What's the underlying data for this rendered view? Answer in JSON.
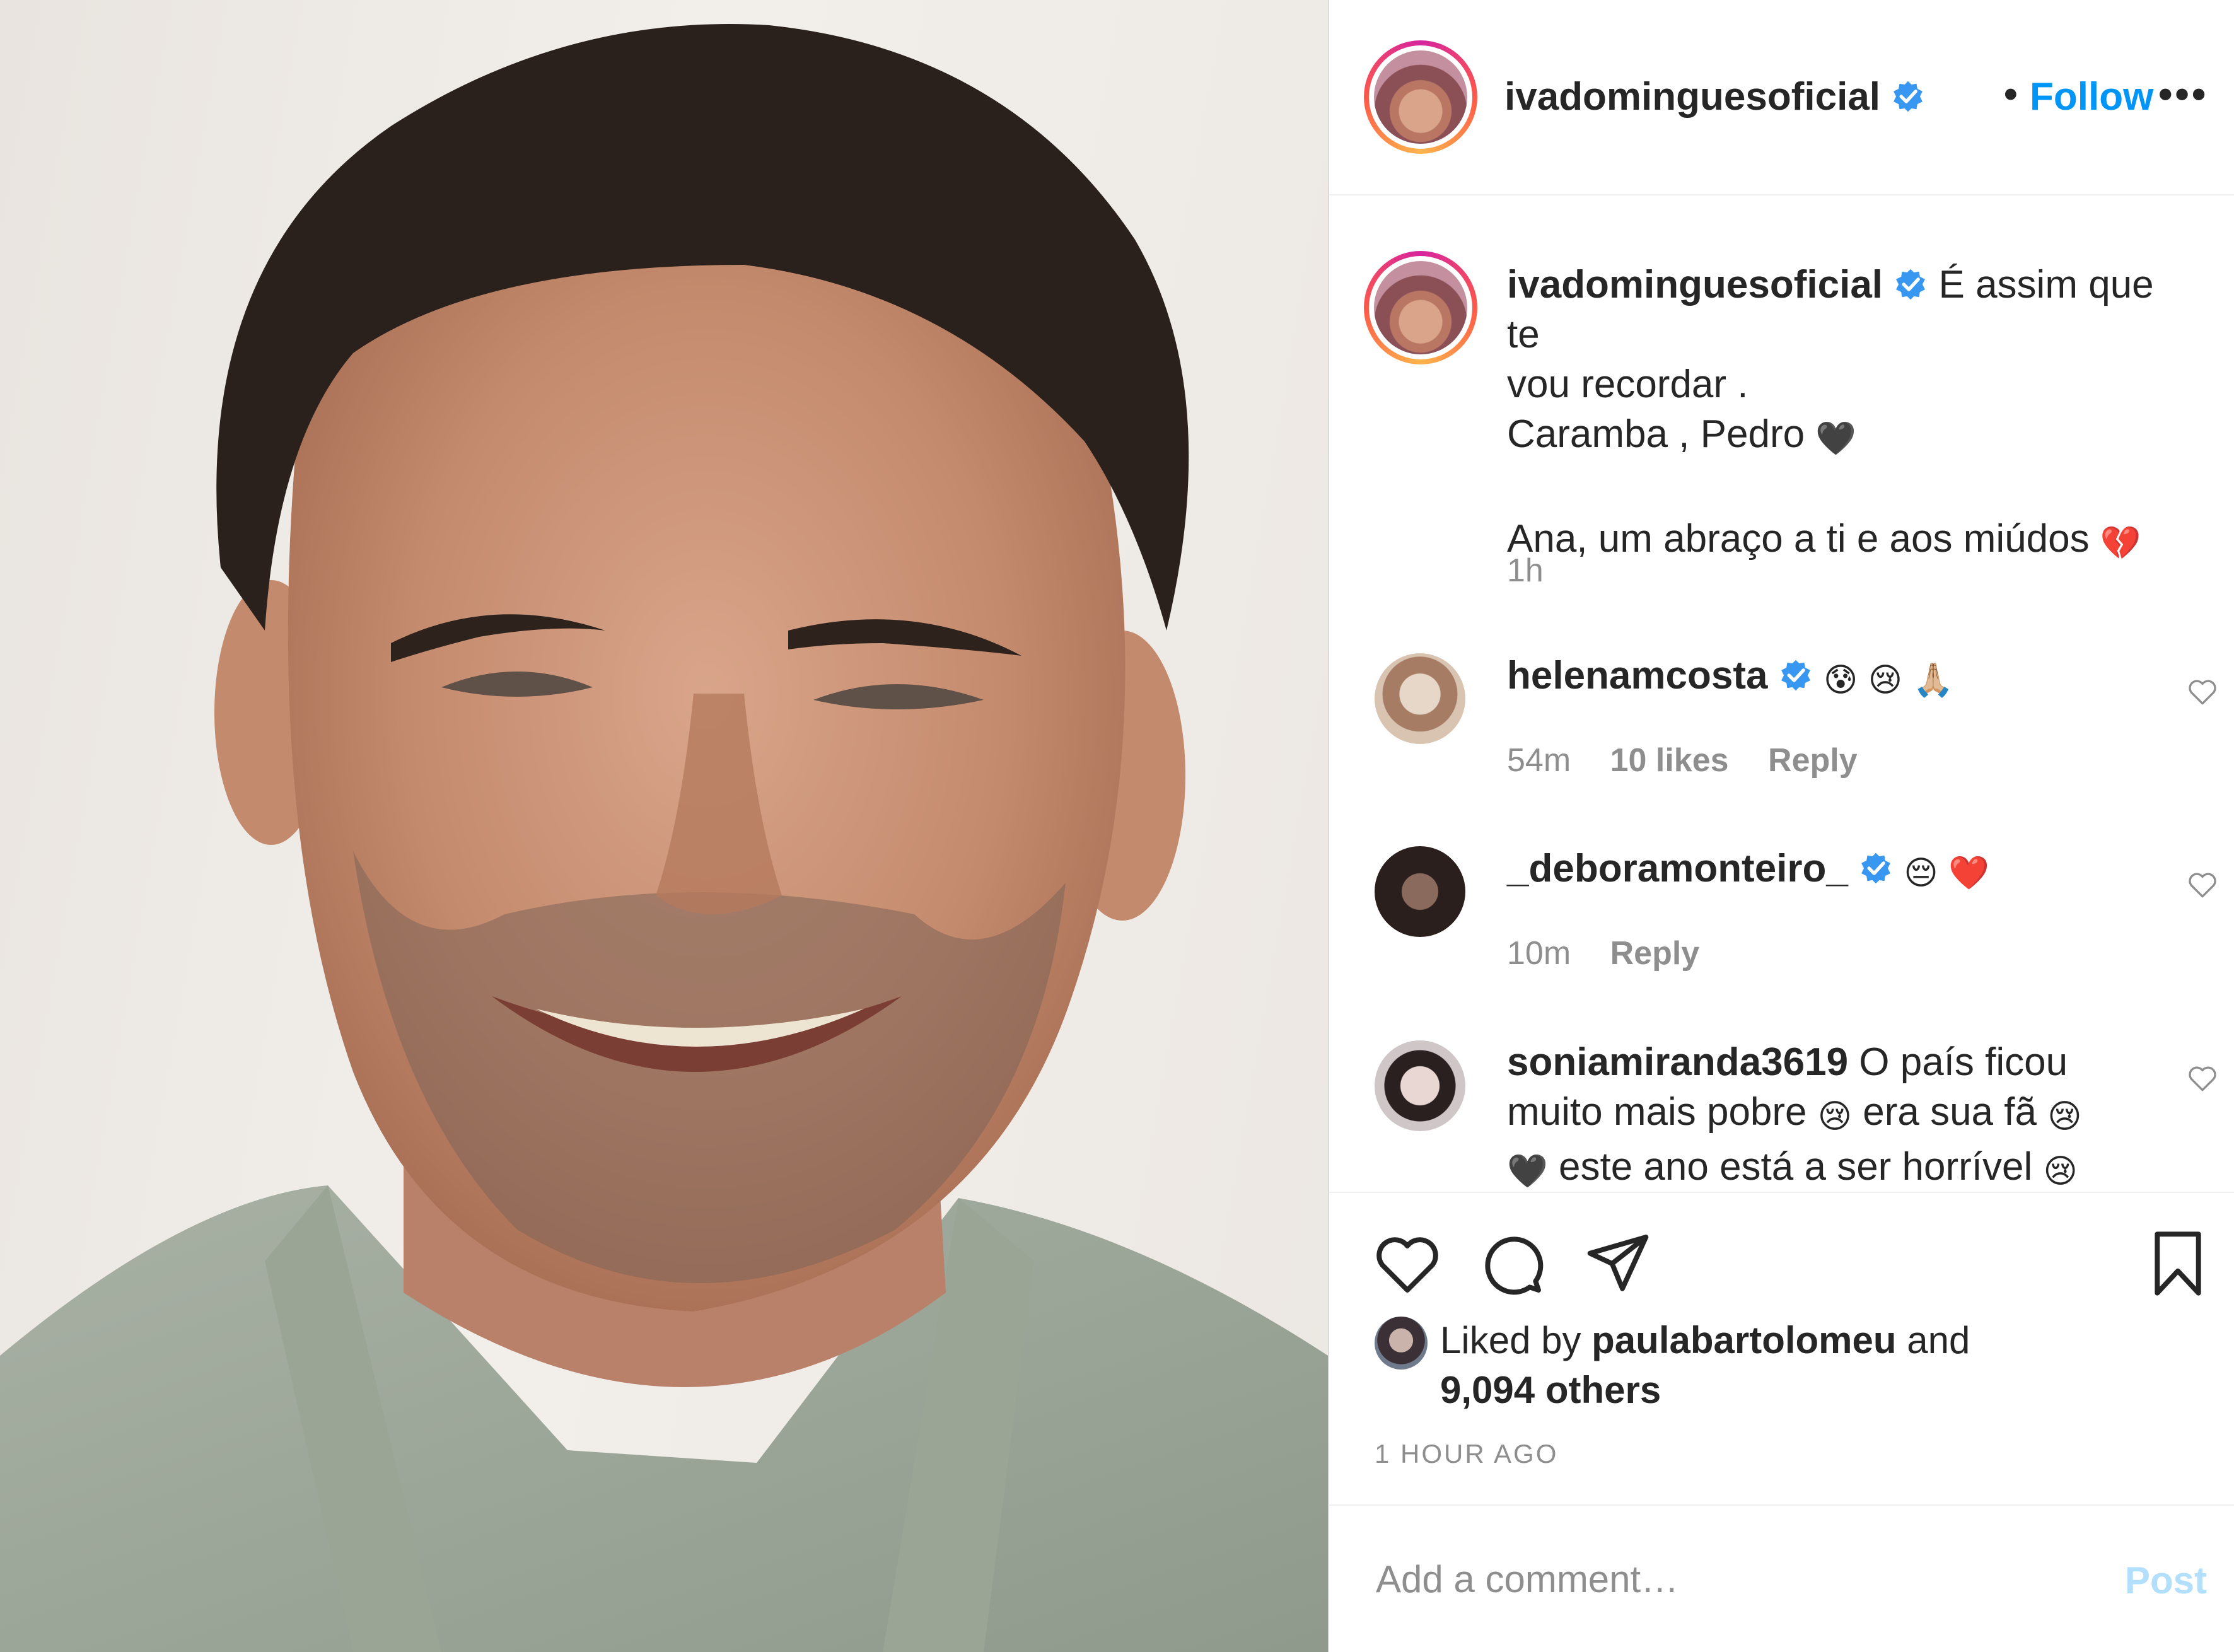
{
  "header": {
    "username": "ivadominguesoficial",
    "separator": "•",
    "follow_label": "Follow",
    "more_label": "•••",
    "verified_icon": "verified-badge-icon"
  },
  "caption": {
    "username": "ivadominguesoficial",
    "line1": "É assim que te",
    "line2": "vou recordar .",
    "line3": "Caramba , Pedro",
    "line3_emoji": "🖤",
    "line4": "Ana, um abraço a ti e aos miúdos",
    "line4_emoji": "💔",
    "time": "1h"
  },
  "comments": [
    {
      "username": "helenamcosta",
      "text": "😰 😢 🙏🏼",
      "time": "54m",
      "likes": "10 likes",
      "reply": "Reply"
    },
    {
      "username": "_deboramonteiro_",
      "text": "😔 ❤️",
      "time": "10m",
      "reply": "Reply"
    },
    {
      "username": "soniamiranda3619",
      "line1": "O país ficou",
      "line2a": "muito mais pobre",
      "emo_a": "😢",
      "line2b": "era sua fã",
      "emo_b": "😢",
      "line3_emoji": "🖤",
      "line3": "este ano está a ser horrível",
      "emo_c": "😢"
    }
  ],
  "likes": {
    "prefix": "Liked by",
    "user": "paulabartolomeu",
    "and": "and",
    "others": "9,094 others"
  },
  "timestamp": "1 HOUR AGO",
  "add_comment": {
    "placeholder": "Add a comment…",
    "post_label": "Post"
  },
  "colors": {
    "accent": "#0095f6",
    "post_disabled": "#b2dffc",
    "verified": "#3897f0",
    "muted": "#8e8e8e"
  }
}
